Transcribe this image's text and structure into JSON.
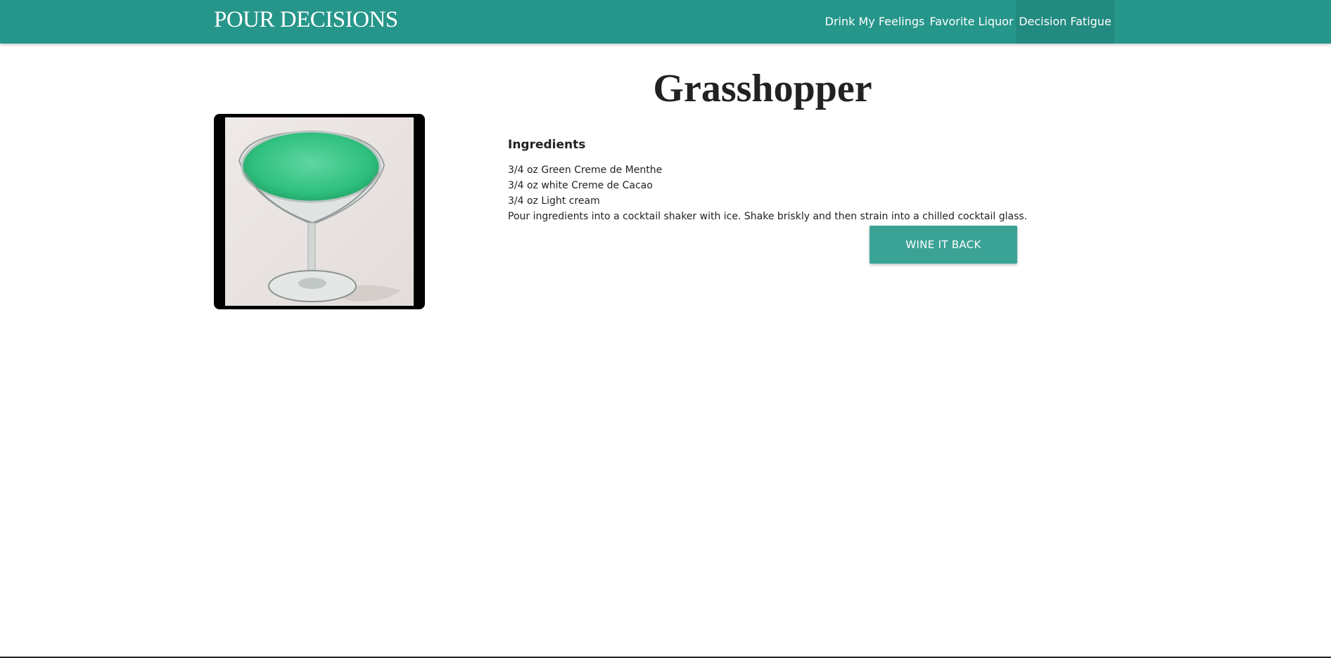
{
  "navbar": {
    "brand": "POUR DECISIONS",
    "links": [
      "Drink My Feelings",
      "Favorite Liquor",
      "Decision Fatigue"
    ],
    "active_link": "Decision Fatigue",
    "background_color": "#26968a"
  },
  "drink": {
    "name": "Grasshopper",
    "image_icon": "cocktail-photo",
    "ingredients_heading": "Ingredients",
    "ingredients": [
      "3/4 oz Green Creme de Menthe",
      "3/4 oz white Creme de Cacao",
      "3/4 oz Light cream"
    ],
    "instructions": "Pour ingredients into a cocktail shaker with ice. Shake briskly and then strain into a chilled cocktail glass."
  },
  "actions": {
    "back_label": "WINE IT BACK",
    "button_color": "#3aa396"
  }
}
